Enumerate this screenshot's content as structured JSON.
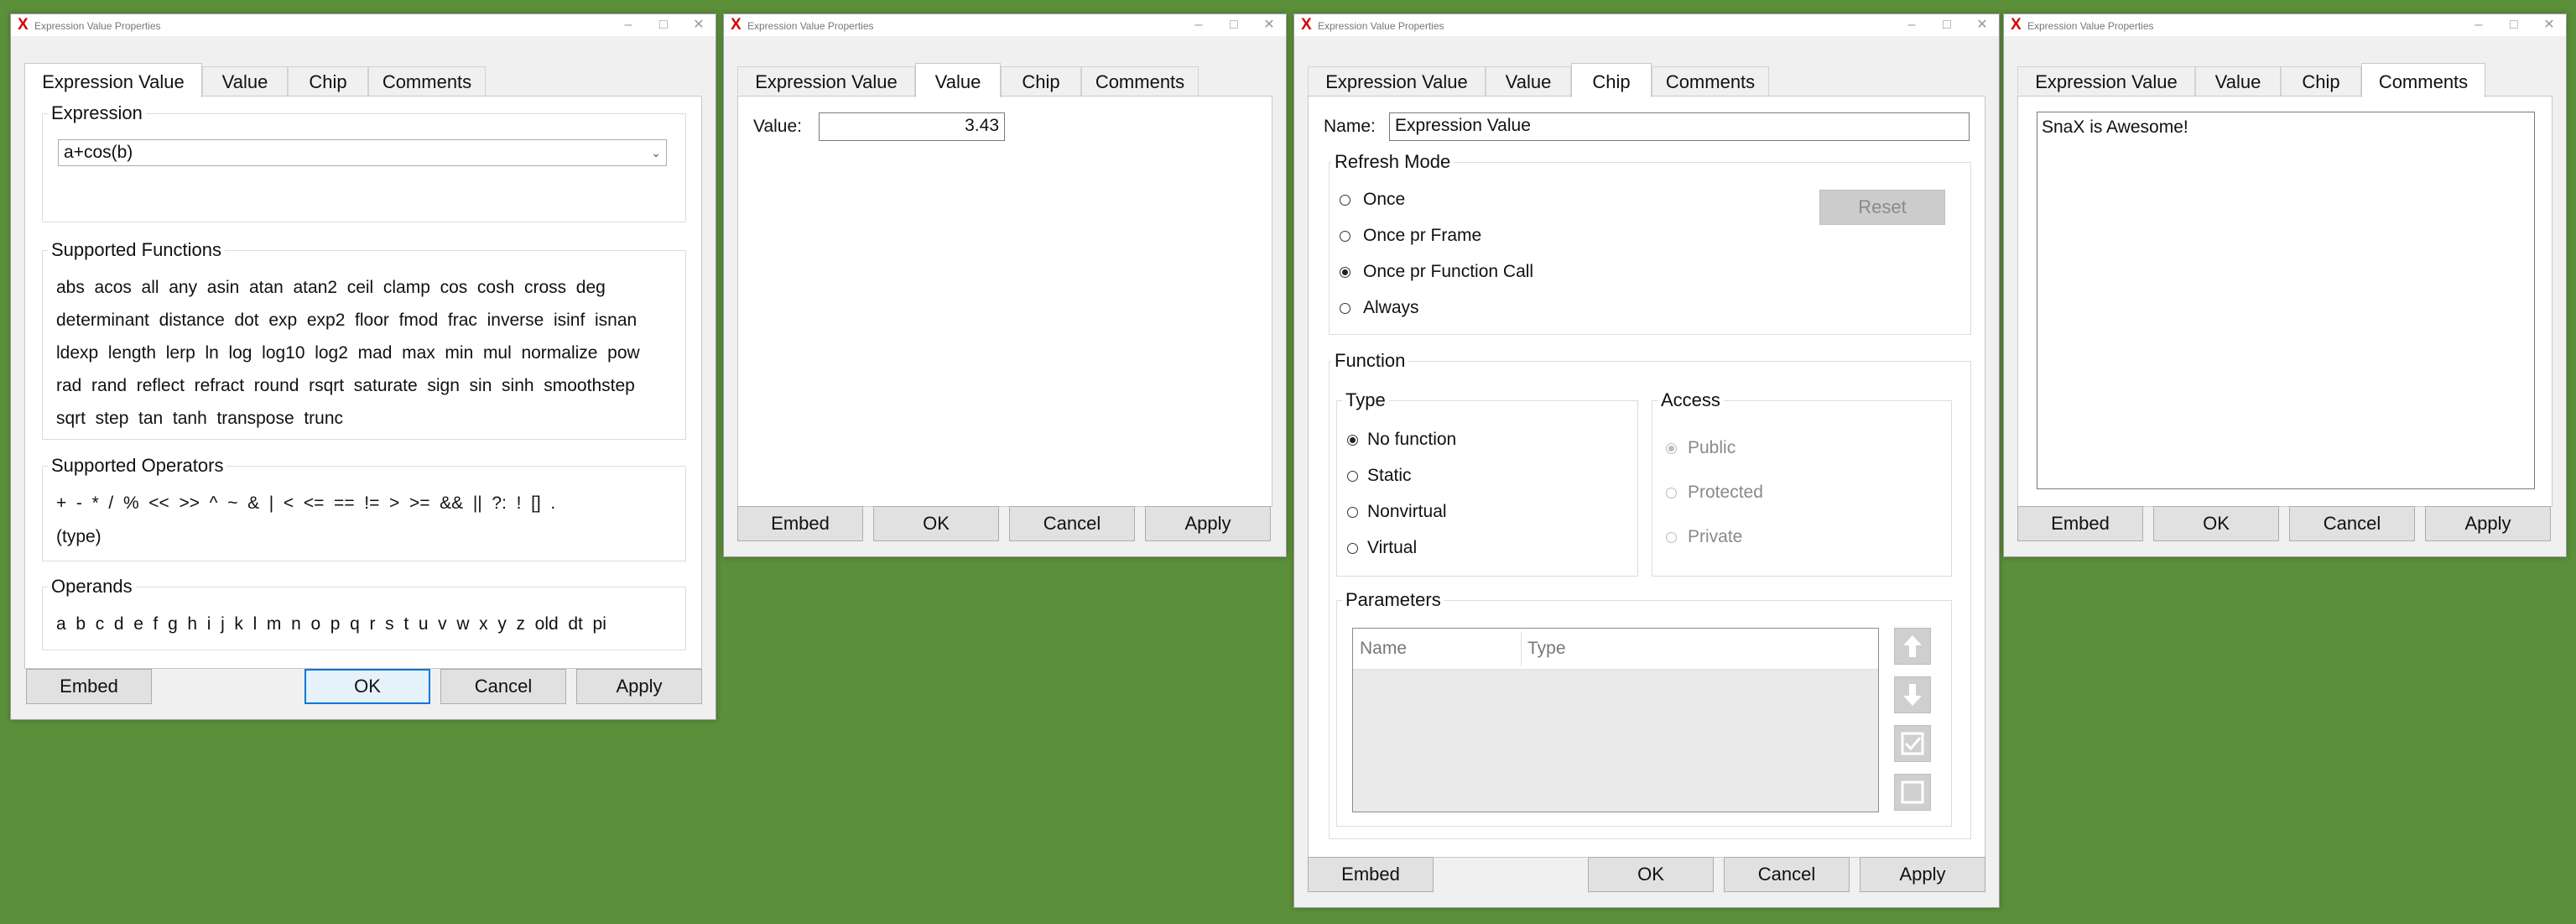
{
  "window_title": "Expression Value Properties",
  "titlebar": {
    "icon": "X",
    "minimize": "–",
    "maximize": "□",
    "close": "✕"
  },
  "tabs": {
    "t1": "Expression Value",
    "t2": "Value",
    "t3": "Chip",
    "t4": "Comments"
  },
  "footer": {
    "embed": "Embed",
    "ok": "OK",
    "cancel": "Cancel",
    "apply": "Apply"
  },
  "expression_tab": {
    "expression_label": "Expression",
    "expression_value": "a+cos(b)",
    "functions_label": "Supported Functions",
    "functions_lines": [
      "abs  acos  all  any  asin  atan  atan2  ceil  clamp  cos  cosh  cross  deg",
      "determinant  distance  dot  exp  exp2  floor  fmod  frac  inverse  isinf  isnan",
      "ldexp  length  lerp  ln  log  log10  log2  mad  max  min  mul  normalize  pow",
      "rad  rand  reflect  refract  round  rsqrt  saturate  sign  sin  sinh  smoothstep",
      "sqrt  step  tan  tanh  transpose  trunc"
    ],
    "operators_label": "Supported Operators",
    "operators_lines": [
      "+  -  *  /  %  <<  >>  ^  ~  &  |  <  <=  ==  !=  >  >=  &&  ||  ?:  !  []  .",
      "(type)"
    ],
    "operands_label": "Operands",
    "operands_line": "a  b  c  d  e  f  g  h  i  j  k  l  m  n  o  p  q  r  s  t  u  v  w  x  y  z  old  dt  pi"
  },
  "value_tab": {
    "value_label": "Value:",
    "value": "3.43"
  },
  "chip_tab": {
    "name_label": "Name:",
    "name_value": "Expression Value",
    "refresh_mode_label": "Refresh Mode",
    "refresh_options": [
      "Once",
      "Once pr Frame",
      "Once pr Function Call",
      "Always"
    ],
    "reset": "Reset",
    "function_label": "Function",
    "type_label": "Type",
    "type_options": [
      "No function",
      "Static",
      "Nonvirtual",
      "Virtual"
    ],
    "access_label": "Access",
    "access_options": [
      "Public",
      "Protected",
      "Private"
    ],
    "parameters_label": "Parameters",
    "param_columns": [
      "Name",
      "Type"
    ]
  },
  "comments_tab": {
    "comment": "SnaX is Awesome!"
  }
}
